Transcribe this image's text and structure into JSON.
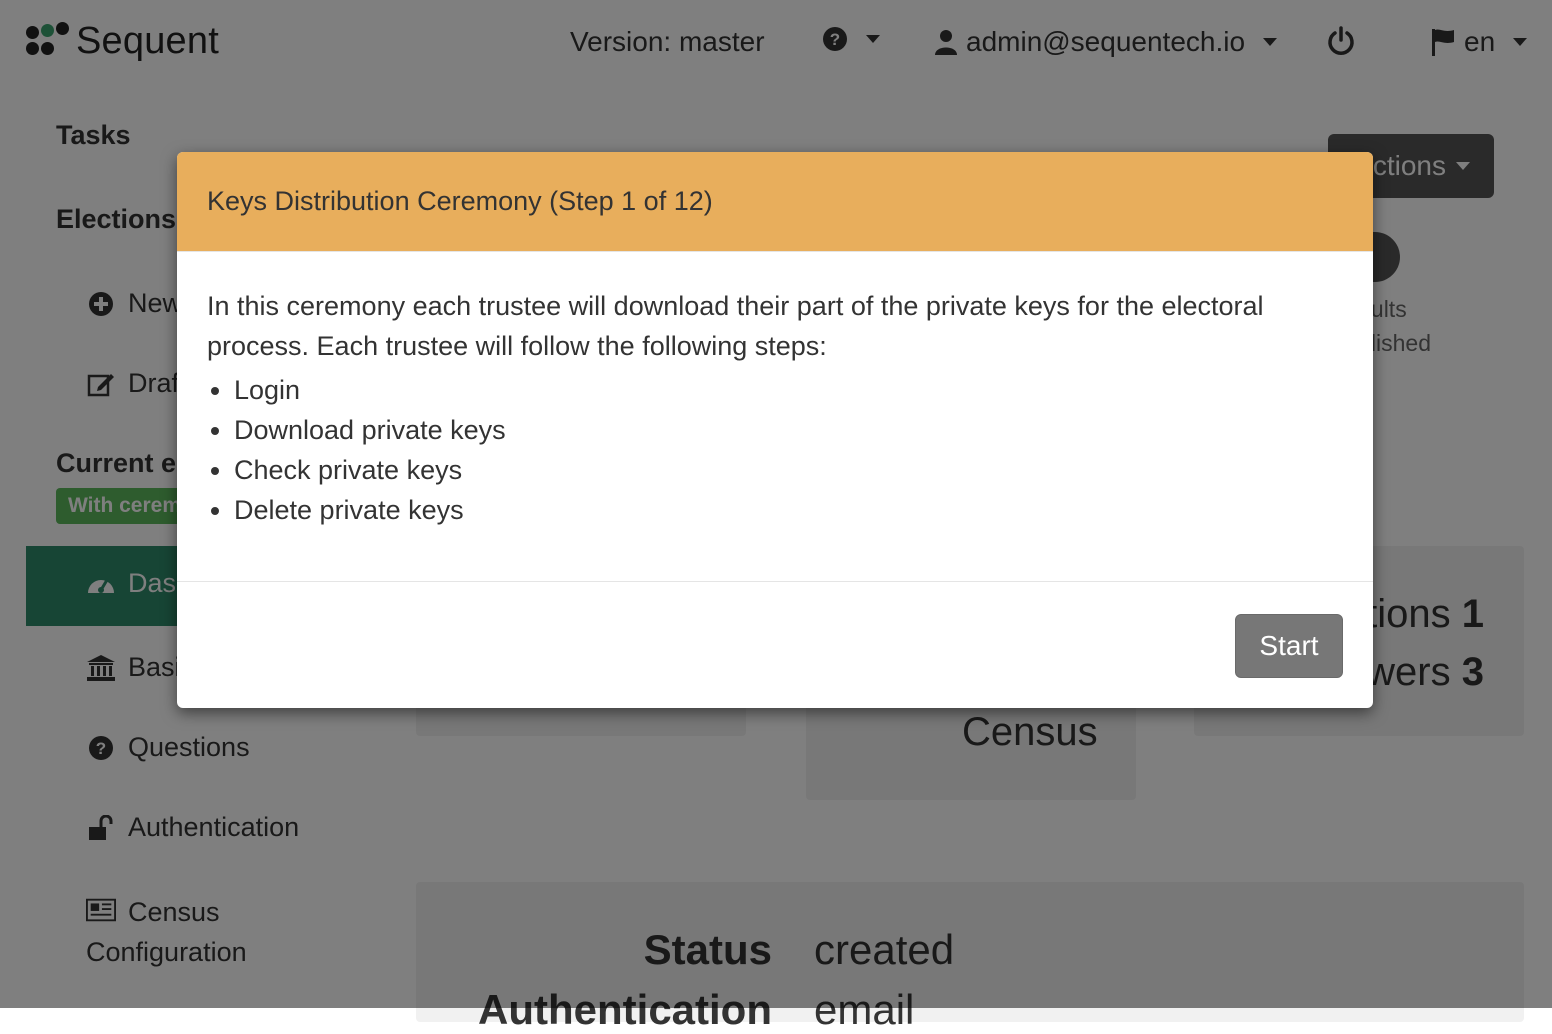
{
  "header": {
    "brand": "Sequent",
    "version_label": "Version: master",
    "help_icon": "question-circle-icon",
    "user_email": "admin@sequentech.io",
    "logout_icon": "power-icon",
    "language": "en"
  },
  "sidebar": {
    "tasks_heading": "Tasks",
    "elections_heading": "Elections",
    "new_label": "New",
    "draft_label": "Draft",
    "current_heading": "Current e",
    "badge": "With ceremony",
    "items": [
      {
        "label": "Dashboard",
        "icon": "dashboard-icon"
      },
      {
        "label": "Basic",
        "icon": "bank-icon"
      },
      {
        "label": "Questions",
        "icon": "question-circle-icon"
      },
      {
        "label": "Authentication",
        "icon": "unlock-icon"
      },
      {
        "label": "Census Configuration",
        "icon": "newspaper-icon"
      }
    ]
  },
  "main": {
    "actions_label": "Actions",
    "results_label": "Results",
    "published_label": "Published",
    "questions_stat_label": "Questions",
    "questions_stat_value": "1",
    "answers_stat_label": "Answers",
    "answers_stat_value": "3",
    "census_label": "Census",
    "status_label": "Status",
    "status_value": "created",
    "authentication_label": "Authentication",
    "authentication_value": "email"
  },
  "modal": {
    "title": "Keys Distribution Ceremony (Step 1 of 12)",
    "intro": "In this ceremony each trustee will download their part of the private keys for the electoral process. Each trustee will follow the following steps:",
    "steps": [
      "Login",
      "Download private keys",
      "Check private keys",
      "Delete private keys"
    ],
    "start_button": "Start"
  },
  "colors": {
    "modal_header": "#e8ae5c",
    "sidebar_active": "#2e8a6a",
    "badge": "#5cb85c"
  }
}
